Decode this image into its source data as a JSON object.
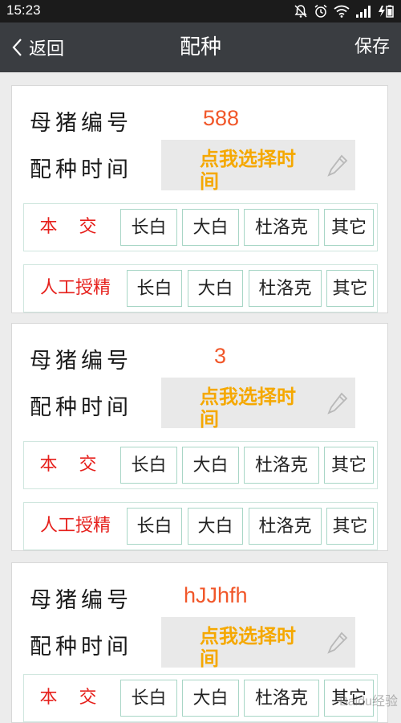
{
  "status_bar": {
    "time": "15:23",
    "icons": [
      "mute-icon",
      "alarm-icon",
      "wifi-icon",
      "signal-icon",
      "battery-charging-icon"
    ]
  },
  "nav": {
    "back_label": "返回",
    "title": "配种",
    "save_label": "保存"
  },
  "labels": {
    "sow_number": "母猪编号",
    "breeding_time": "配种时间",
    "natural_mating": "本 交",
    "artificial_insemination": "人工授精"
  },
  "time_placeholder": "点我选择时间",
  "breeds": [
    "长白",
    "大白",
    "杜洛克",
    "其它"
  ],
  "records": [
    {
      "sow_number": "588"
    },
    {
      "sow_number": "3"
    },
    {
      "sow_number": "hJJhfh"
    }
  ],
  "colors": {
    "nav_bg": "#3a3d41",
    "status_bg": "#1b1b1b",
    "accent_red": "#e6201c",
    "value_orange": "#f1572a",
    "placeholder_yellow": "#f5a800"
  },
  "watermark": "Baidu经验"
}
